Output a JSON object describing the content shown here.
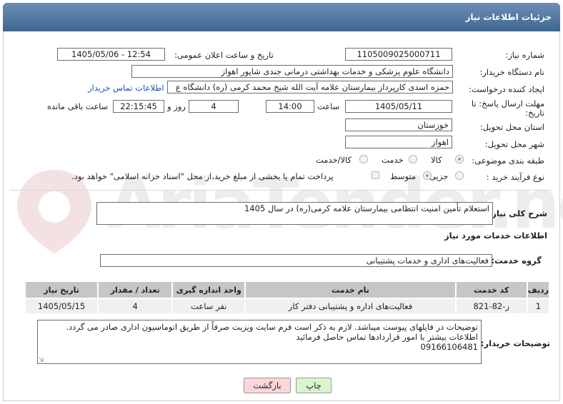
{
  "header": {
    "title": "جزئیات اطلاعات نیاز"
  },
  "form": {
    "need_number_label": "شماره نیاز:",
    "need_number": "1105009025000711",
    "announce_label": "تاریخ و ساعت اعلان عمومی:",
    "announce_value": "1405/05/06 - 12:54",
    "buyer_org_label": "نام دستگاه خریدار:",
    "buyer_org": "دانشگاه علوم پزشکی و خدمات بهداشتی درمانی جندی شاپور اهواز",
    "requester_label": "ایجاد کننده درخواست:",
    "requester": "حمزه اسدی کارپرداز بیمارستان علامه آیت الله شیخ محمد کرمی (ره) دانشگاه ع",
    "contact_link": "اطلاعات تماس خریدار",
    "deadline_label_1": "مهلت ارسال پاسخ: تا",
    "deadline_label_2": "تاریخ:",
    "deadline_date": "1405/05/11",
    "time_label": "ساعت",
    "deadline_time": "14:00",
    "days_value": "4",
    "days_label": "روز و",
    "remaining_value": "22:15:45",
    "remaining_label": "ساعت باقی مانده",
    "province_label": "استان محل تحویل:",
    "province": "خوزستان",
    "city_label": "شهر محل تحویل:",
    "city": "اهواز",
    "category_label": "طبقه بندی موضوعی:",
    "category_options": [
      "کالا",
      "خدمت",
      "کالا/خدمت"
    ],
    "purchase_type_label": "نوع فرآیند خرید :",
    "purchase_options": [
      "جزیی",
      "متوسط"
    ],
    "payment_note": "پرداخت تمام یا بخشی از مبلغ خرید،از محل \"اسناد خزانه اسلامی\" خواهد بود."
  },
  "summary": {
    "label": "شرح کلی نیاز:",
    "value": "استعلام تأمین امنیت انتظامی بیمارستان علامه کرمی(ره) در سال 1405"
  },
  "services": {
    "section_title": "اطلاعات خدمات مورد نیاز",
    "group_label": "گروه خدمت:",
    "group_value": "فعالیت‌های اداری و خدمات پشتیبانی",
    "columns": [
      "ردیف",
      "کد خدمت",
      "نام خدمت",
      "واحد اندازه گیری",
      "تعداد / مقدار",
      "تاریخ نیاز"
    ],
    "rows": [
      [
        "1",
        "ز-82-821",
        "فعالیت‌های اداره و پشتیبانی دفتر کار",
        "نفر ساعت",
        "4",
        "1405/05/15"
      ]
    ]
  },
  "buyer_notes": {
    "label": "توضیحات خریدار:",
    "lines": [
      "توضیحات در فایلهای پیوست میباشد. لازم به ذکر است فرم سایت ویزیت صرفاً از طریق اتوماسیون اداری صادر می گردد.",
      "اطلاعات بیشتر با امور قراردادها تماس حاصل فرمائید",
      "09166106481"
    ]
  },
  "buttons": {
    "print": "چاپ",
    "back": "بازگشت"
  },
  "watermark": {
    "text": "AriaTender.net"
  },
  "colors": {
    "header_bg": "#4f77a1",
    "print_bg": "#d9f5cf",
    "back_bg": "#fbd6db",
    "link": "#1b52b8"
  }
}
